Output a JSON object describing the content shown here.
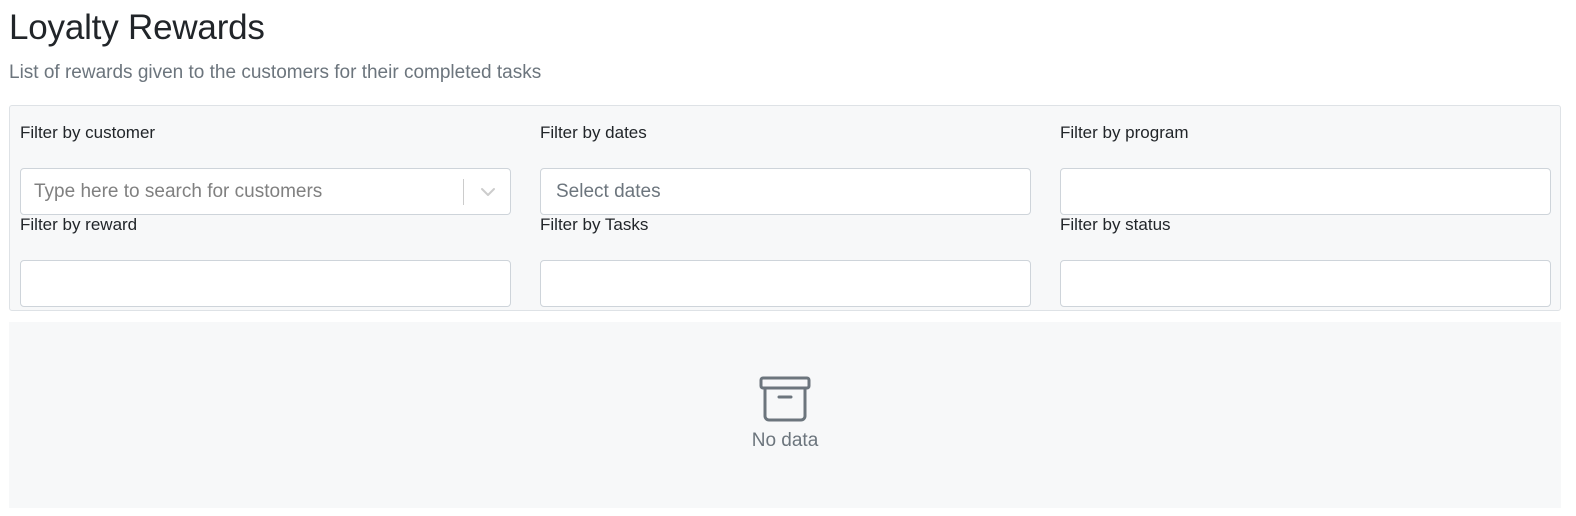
{
  "header": {
    "title": "Loyalty Rewards",
    "subtitle": "List of rewards given to the customers for their completed tasks"
  },
  "filters": {
    "customer": {
      "label": "Filter by customer",
      "placeholder": "Type here to search for customers",
      "icon": "chevron-down-icon"
    },
    "dates": {
      "label": "Filter by dates",
      "placeholder": "Select dates",
      "value": ""
    },
    "program": {
      "label": "Filter by program",
      "value": ""
    },
    "reward": {
      "label": "Filter by reward",
      "value": ""
    },
    "tasks": {
      "label": "Filter by Tasks",
      "value": ""
    },
    "status": {
      "label": "Filter by status",
      "value": ""
    }
  },
  "empty_state": {
    "icon": "archive-box-icon",
    "text": "No data"
  },
  "colors": {
    "panel_background": "#f7f8f9",
    "border": "#ced4da",
    "muted_text": "#6c757d",
    "heading_text": "#212529"
  }
}
